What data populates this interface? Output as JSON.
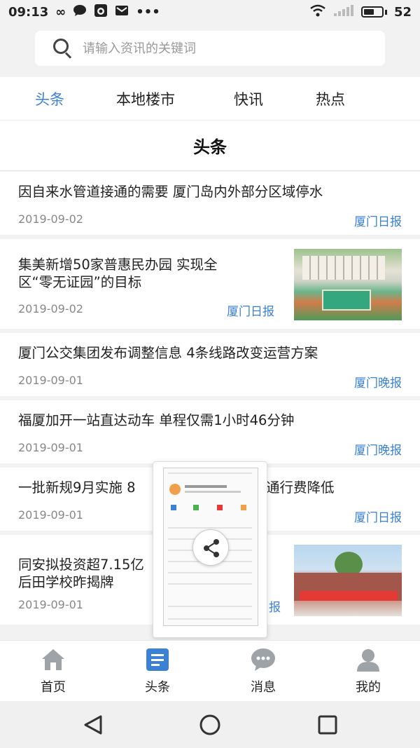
{
  "status_bar": {
    "time": "09:13",
    "battery": "52",
    "icons": [
      "infinity-icon",
      "chat-bubble-icon",
      "uc-browser-icon",
      "mail-icon",
      "more-dots-icon",
      "wifi-icon",
      "signal-icon",
      "battery-icon"
    ]
  },
  "search": {
    "placeholder": "请输入资讯的关键词"
  },
  "tabs": [
    {
      "label": "头条",
      "active": true
    },
    {
      "label": "本地楼市",
      "active": false
    },
    {
      "label": "快讯",
      "active": false
    },
    {
      "label": "热点",
      "active": false
    }
  ],
  "page": {
    "title": "头条"
  },
  "news": [
    {
      "title": "因自来水管道接通的需要 厦门岛内外部分区域停水",
      "date": "2019-09-02",
      "source": "厦门日报"
    },
    {
      "title_line1": "集美新增50家普惠民办园 实现全",
      "title_line2": "区“零无证园”的目标",
      "date": "2019-09-02",
      "source": "厦门日报"
    },
    {
      "title": "厦门公交集团发布调整信息 4条线路改变运营方案",
      "date": "2019-09-01",
      "source": "厦门晚报"
    },
    {
      "title": "福厦加开一站直达动车 单程仅需1小时46分钟",
      "date": "2019-09-01",
      "source": "厦门晚报"
    },
    {
      "title_left": "一批新规9月实施 8",
      "title_right": "通行费降低",
      "date": "2019-09-01",
      "source": "厦门日报"
    },
    {
      "title_line1": "同安拟投资超7.15亿",
      "title_line2": "后田学校昨揭牌",
      "date": "2019-09-01",
      "source": "报"
    }
  ],
  "bottom_nav": [
    {
      "label": "首页",
      "icon": "home-icon",
      "active": false
    },
    {
      "label": "头条",
      "icon": "document-icon",
      "active": true
    },
    {
      "label": "消息",
      "icon": "message-icon",
      "active": false
    },
    {
      "label": "我的",
      "icon": "user-icon",
      "active": false
    }
  ],
  "colors": {
    "accent": "#3b82d6",
    "text": "#222222",
    "muted": "#888888",
    "background": "#f2f2f2"
  }
}
